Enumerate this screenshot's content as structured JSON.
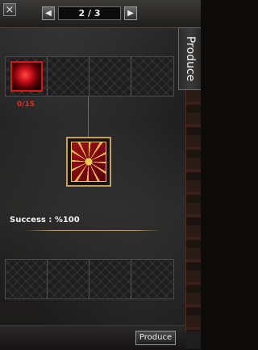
{
  "header": {
    "close_label": "×",
    "prev_icon": "arrow-left-icon",
    "next_icon": "arrow-right-icon",
    "prev_label": "◀",
    "next_label": "▶",
    "page_indicator": "2 / 3"
  },
  "side_tab": {
    "label": "Produce"
  },
  "materials": {
    "slots": [
      {
        "item": "red-orb-icon",
        "filled": true
      },
      {
        "filled": false
      },
      {
        "filled": false
      },
      {
        "filled": false
      }
    ],
    "first_count": "0/15"
  },
  "result": {
    "item": "red-card-deck-icon"
  },
  "success": {
    "text": "Success : %100"
  },
  "output_slots": [
    {
      "filled": false
    },
    {
      "filled": false
    },
    {
      "filled": false
    },
    {
      "filled": false
    }
  ],
  "footer": {
    "produce_label": "Produce"
  },
  "colors": {
    "accent_gold": "#c8a050",
    "count_red": "#e22a2a"
  }
}
